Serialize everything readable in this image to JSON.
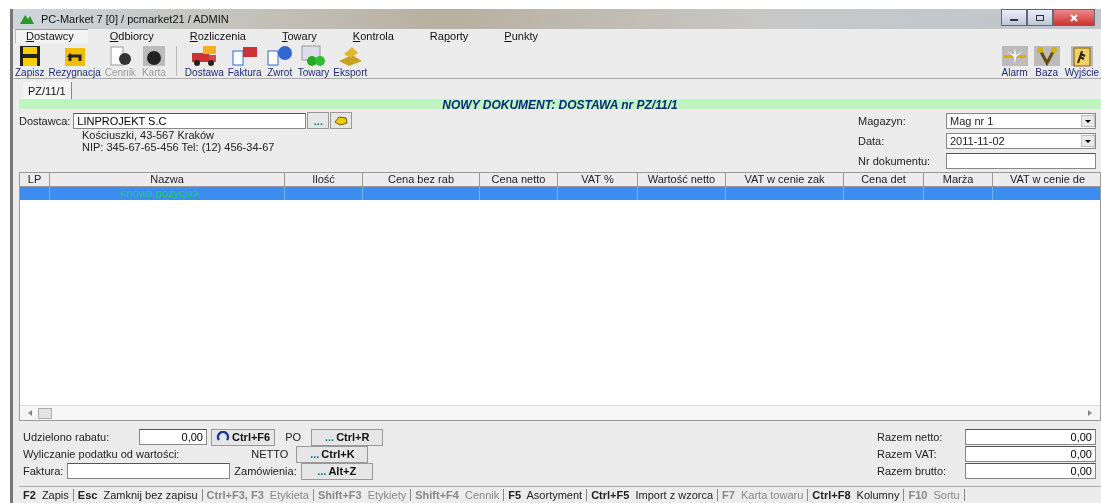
{
  "window": {
    "title": "PC-Market 7 [0] / pcmarket21 / ADMIN"
  },
  "menu": [
    {
      "key": "D",
      "post": "ostawcy",
      "selected": true
    },
    {
      "key": "O",
      "post": "dbiorcy",
      "selected": false
    },
    {
      "key": "R",
      "post": "ozliczenia",
      "selected": false
    },
    {
      "key": "T",
      "post": "owary",
      "selected": false
    },
    {
      "key": "K",
      "post": "ontrola",
      "selected": false
    },
    {
      "pre": "Ra",
      "key": "p",
      "post": "orty",
      "selected": false
    },
    {
      "key": "P",
      "post": "unkty",
      "selected": false
    }
  ],
  "toolbar_left": [
    {
      "label": "Zapisz",
      "kind": "floppy",
      "disabled": false
    },
    {
      "label": "Rezygnacja",
      "kind": "undo",
      "disabled": false
    },
    {
      "label": "Cennik",
      "kind": "pricelist",
      "disabled": true
    },
    {
      "label": "Karta",
      "kind": "apple",
      "disabled": true
    },
    {
      "label": "Dostawa",
      "kind": "truck",
      "disabled": false
    },
    {
      "label": "Faktura",
      "kind": "invoice",
      "disabled": false
    },
    {
      "label": "Zwrot",
      "kind": "return",
      "disabled": false
    },
    {
      "label": "Towary",
      "kind": "goods",
      "disabled": false
    },
    {
      "label": "Eksport",
      "kind": "export",
      "disabled": false
    }
  ],
  "toolbar_right": [
    {
      "label": "Alarm",
      "kind": "alarm",
      "disabled": false
    },
    {
      "label": "Baza",
      "kind": "base",
      "disabled": false
    },
    {
      "label": "Wyjście",
      "kind": "exit",
      "disabled": false
    }
  ],
  "doc_tabs": [
    {
      "label": "PZ/11/1",
      "selected": true
    }
  ],
  "banner": "NOWY DOKUMENT: DOSTAWA nr PZ/11/1",
  "supplier": {
    "label": "Dostawca:",
    "value": "LINPROJEKT S.C",
    "browse": "...",
    "address": "Kościuszki, 43-567 Kraków",
    "details": "NIP: 345-67-65-456 Tel: (12) 456-34-67"
  },
  "doc_fields": [
    {
      "label": "Magazyn:",
      "value": "Mag nr 1",
      "kind": "dropdown"
    },
    {
      "label": "Data:",
      "value": "2011-11-02",
      "kind": "dropdown"
    },
    {
      "label": "Nr dokumentu:",
      "kind": "input"
    }
  ],
  "table": {
    "columns": [
      "LP",
      "Nazwa",
      "Ilość",
      "Cena bez rab",
      "Cena netto",
      "VAT %",
      "Wartość netto",
      "VAT w cenie zak",
      "Cena det",
      "Marża",
      "VAT w cenie de"
    ],
    "rows": [
      {
        "selected": true,
        "nazwa": "<nowa pozycja>"
      }
    ]
  },
  "discount": {
    "label": "Udzielono rabatu:",
    "value": "0,00",
    "button": "Ctrl+F6",
    "mode": "PO",
    "mode_button": "... Ctrl+R"
  },
  "tax": {
    "label": "Wyliczanie podatku od wartości:",
    "value": "NETTO",
    "button": "... Ctrl+K"
  },
  "invoice": {
    "label": "Faktura:",
    "orders_label": "Zamówienia:",
    "orders_button": "... Alt+Z"
  },
  "totals": [
    {
      "label": "Razem netto:",
      "value": "0,00"
    },
    {
      "label": "Razem VAT:",
      "value": "0,00"
    },
    {
      "label": "Razem brutto:",
      "value": "0,00"
    }
  ],
  "status_bar": [
    {
      "key": "F2",
      "label": "Zapis",
      "disabled": false
    },
    {
      "key": "Esc",
      "label": "Zamknij bez zapisu",
      "disabled": false
    },
    {
      "key": "Ctrl+F3, F3",
      "label": "Etykieta",
      "disabled": true
    },
    {
      "key": "Shift+F3",
      "label": "Etykiety",
      "disabled": true
    },
    {
      "key": "Shift+F4",
      "label": "Cennik",
      "disabled": true
    },
    {
      "key": "F5",
      "label": "Asortyment",
      "disabled": false
    },
    {
      "key": "Ctrl+F5",
      "label": "Import z wzorca",
      "disabled": false
    },
    {
      "key": "F7",
      "label": "Karta towaru",
      "disabled": true
    },
    {
      "key": "Ctrl+F8",
      "label": "Kolumny",
      "disabled": false
    },
    {
      "key": "F10",
      "label": "Sortu",
      "disabled": true
    }
  ]
}
